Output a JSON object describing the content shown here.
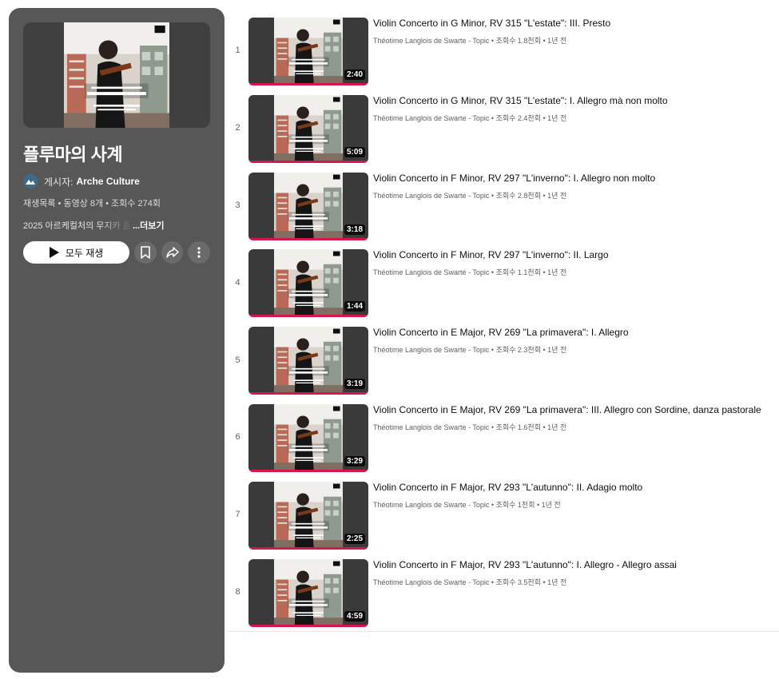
{
  "playlist": {
    "cover_text": {
      "label_top": "harmonia mundi",
      "composer": "ANTONIO VIVALDI",
      "title": "LE QUATTRO STAGIONI",
      "subtitle": "FOR STRINGS & ORCHESTRA",
      "performer": "THÉOTIME LANGLOIS DE SWARTE",
      "ensemble": "ORCHESTRE LE CONSORT"
    },
    "title": "플루마의 사계",
    "owner_prefix": "게시자:",
    "owner_name": "Arche Culture",
    "meta": "재생목록 • 동영상 8개 • 조회수 274회",
    "description": "2025 아르케컬처의 무지카 클래시카",
    "more_label": "...더보기",
    "play_all_label": "모두 재생"
  },
  "videos": [
    {
      "index": "1",
      "title": "Violin Concerto in G Minor, RV 315 \"L'estate\": III. Presto",
      "channel": "Théotime Langlois de Swarte - Topic",
      "views": "조회수 1.8천회",
      "age": "1년 전",
      "duration": "2:40"
    },
    {
      "index": "2",
      "title": "Violin Concerto in G Minor, RV 315 \"L'estate\": I. Allegro mà non molto",
      "channel": "Théotime Langlois de Swarte - Topic",
      "views": "조회수 2.4천회",
      "age": "1년 전",
      "duration": "5:09"
    },
    {
      "index": "3",
      "title": "Violin Concerto in F Minor, RV 297 \"L'inverno\": I. Allegro non molto",
      "channel": "Théotime Langlois de Swarte - Topic",
      "views": "조회수 2.8천회",
      "age": "1년 전",
      "duration": "3:18"
    },
    {
      "index": "4",
      "title": "Violin Concerto in F Minor, RV 297 \"L'inverno\": II. Largo",
      "channel": "Théotime Langlois de Swarte - Topic",
      "views": "조회수 1.1천회",
      "age": "1년 전",
      "duration": "1:44"
    },
    {
      "index": "5",
      "title": "Violin Concerto in E Major, RV 269 \"La primavera\": I. Allegro",
      "channel": "Théotime Langlois de Swarte - Topic",
      "views": "조회수 2.3천회",
      "age": "1년 전",
      "duration": "3:19"
    },
    {
      "index": "6",
      "title": "Violin Concerto in E Major, RV 269 \"La primavera\": III. Allegro con Sordine, danza pastorale",
      "channel": "Théotime Langlois de Swarte - Topic",
      "views": "조회수 1.6천회",
      "age": "1년 전",
      "duration": "3:29"
    },
    {
      "index": "7",
      "title": "Violin Concerto in F Major, RV 293 \"L'autunno\": II. Adagio molto",
      "channel": "Théotime Langlois de Swarte - Topic",
      "views": "조회수 1천회",
      "age": "1년 전",
      "duration": "2:25"
    },
    {
      "index": "8",
      "title": "Violin Concerto in F Major, RV 293 \"L'autunno\": I. Allegro - Allegro assai",
      "channel": "Théotime Langlois de Swarte - Topic",
      "views": "조회수 3.5천회",
      "age": "1년 전",
      "duration": "4:59"
    }
  ],
  "icons": {
    "play": "play-icon",
    "save": "bookmark-icon",
    "share": "share-icon",
    "more": "more-vert-icon"
  },
  "colors": {
    "panel_bg": "#575757",
    "progress": "#d6174e"
  }
}
